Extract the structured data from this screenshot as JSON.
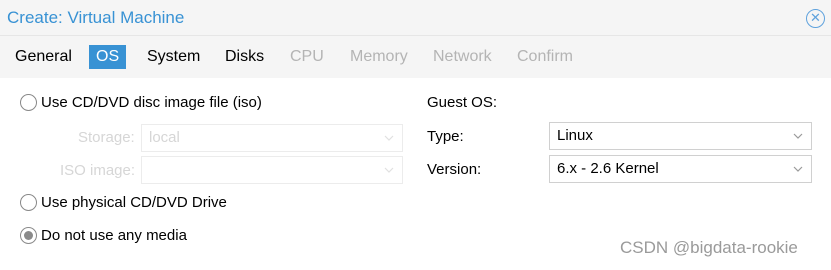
{
  "window": {
    "title": "Create: Virtual Machine",
    "close_icon": "close-circle-icon",
    "accent_color": "#3892d4"
  },
  "tabs": [
    {
      "label": "General",
      "state": "normal"
    },
    {
      "label": "OS",
      "state": "active"
    },
    {
      "label": "System",
      "state": "normal"
    },
    {
      "label": "Disks",
      "state": "normal"
    },
    {
      "label": "CPU",
      "state": "disabled"
    },
    {
      "label": "Memory",
      "state": "disabled"
    },
    {
      "label": "Network",
      "state": "disabled"
    },
    {
      "label": "Confirm",
      "state": "disabled"
    }
  ],
  "media": {
    "option_iso": {
      "label": "Use CD/DVD disc image file (iso)",
      "checked": false
    },
    "storage": {
      "label": "Storage:",
      "value": "local",
      "disabled": true
    },
    "iso_image": {
      "label": "ISO image:",
      "value": "",
      "disabled": true
    },
    "option_physical": {
      "label": "Use physical CD/DVD Drive",
      "checked": false
    },
    "option_none": {
      "label": "Do not use any media",
      "checked": true
    }
  },
  "guest_os": {
    "heading": "Guest OS:",
    "type": {
      "label": "Type:",
      "value": "Linux"
    },
    "version": {
      "label": "Version:",
      "value": "6.x - 2.6 Kernel"
    }
  },
  "watermark": "CSDN @bigdata-rookie"
}
